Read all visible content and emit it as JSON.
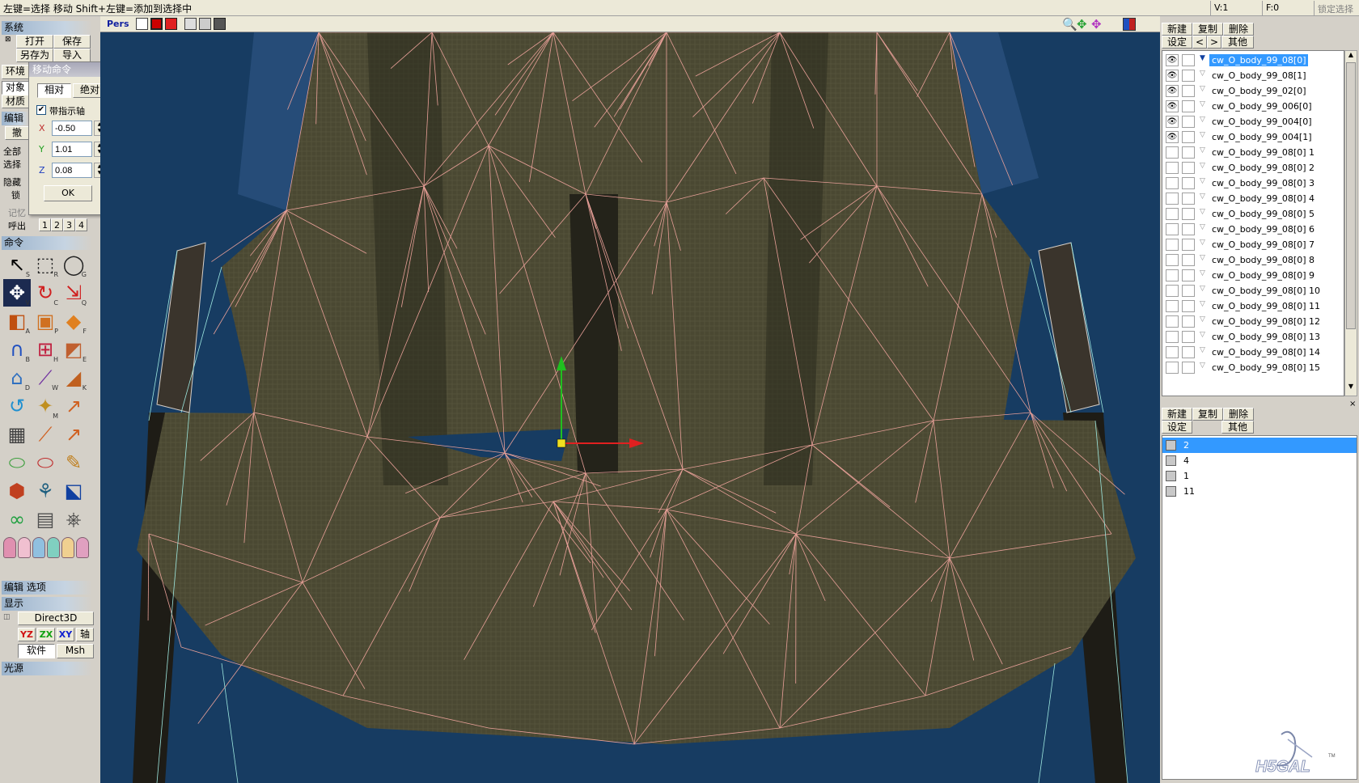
{
  "status_bar": {
    "hint": "左键=选择 移动  Shift+左键=添加到选择中",
    "vertex_count": "V:1",
    "face_count": "F:0",
    "lock_label": "锁定选择"
  },
  "left_panel": {
    "system_header": "系统",
    "open_label": "打开",
    "save_label": "保存",
    "saveas_label": "另存为",
    "import_label": "导入",
    "env_label": "环境",
    "object_label": "对象",
    "material_label": "材质",
    "edit_header": "编辑",
    "edit_btn_label": "撤",
    "all_label": "全部",
    "select_label": "选择",
    "hide_label": "隐藏",
    "lock_label": "锁",
    "memory_label": "记忆",
    "recall_label": "呼出",
    "slots": [
      "1",
      "2",
      "3",
      "4"
    ],
    "command_header": "命令",
    "edit_option_header": "编辑 选项",
    "display_header": "显示",
    "display_mode": "Direct3D",
    "axis_yz": "YZ",
    "axis_zx": "ZX",
    "axis_xy": "XY",
    "axis_label": "轴",
    "software_label": "软件",
    "msh_label": "Msh",
    "light_header": "光源",
    "tools": [
      {
        "icon": "select-arrow-icon",
        "key": "S"
      },
      {
        "icon": "rect-select-icon",
        "key": "R"
      },
      {
        "icon": "lasso-icon",
        "key": "G"
      },
      {
        "icon": "move-icon",
        "key": "V"
      },
      {
        "icon": "rotate-icon",
        "key": "C"
      },
      {
        "icon": "scale-icon",
        "key": "Q"
      },
      {
        "icon": "face-create-icon",
        "key": "A"
      },
      {
        "icon": "box-icon",
        "key": "P"
      },
      {
        "icon": "plane-icon",
        "key": "F"
      },
      {
        "icon": "magnet-icon",
        "key": "B"
      },
      {
        "icon": "knife-icon",
        "key": "H"
      },
      {
        "icon": "extrude-icon",
        "key": "E"
      },
      {
        "icon": "delete-bucket-icon",
        "key": "D"
      },
      {
        "icon": "weld-icon",
        "key": "W"
      },
      {
        "icon": "bevel-icon",
        "key": "K"
      },
      {
        "icon": "twist-icon",
        "key": ""
      },
      {
        "icon": "wand-icon",
        "key": "M"
      },
      {
        "icon": "bend-icon",
        "key": ""
      },
      {
        "icon": "lattice-icon",
        "key": ""
      },
      {
        "icon": "curve-icon",
        "key": ""
      },
      {
        "icon": "path-icon",
        "key": ""
      },
      {
        "icon": "cylinder-icon",
        "key": ""
      },
      {
        "icon": "cylinder-edit-icon",
        "key": ""
      },
      {
        "icon": "paint-icon",
        "key": ""
      },
      {
        "icon": "cube-edit-icon",
        "key": ""
      },
      {
        "icon": "bone-icon",
        "key": ""
      },
      {
        "icon": "nodes-icon",
        "key": ""
      },
      {
        "icon": "link-icon",
        "key": ""
      },
      {
        "icon": "script-icon",
        "key": ""
      },
      {
        "icon": "camera-icon",
        "key": ""
      }
    ]
  },
  "move_dialog": {
    "title": "移动命令",
    "relative_label": "相对",
    "absolute_label": "绝对",
    "show_axis_label": "带指示轴",
    "x_label": "X",
    "y_label": "Y",
    "z_label": "Z",
    "x_value": "-0.50",
    "y_value": "1.01",
    "z_value": "0.08",
    "ok_label": "OK"
  },
  "viewport": {
    "mode_label": "Pers"
  },
  "object_panel": {
    "new_label": "新建",
    "copy_label": "复制",
    "delete_label": "删除",
    "settings_label": "设定",
    "prev_label": "<",
    "next_label": ">",
    "other_label": "其他",
    "objects": [
      {
        "name": "cw_O_body_99_08[0]",
        "visible": true,
        "selected": true,
        "expand": "▼"
      },
      {
        "name": "cw_O_body_99_08[1]",
        "visible": true,
        "selected": false,
        "expand": "▽"
      },
      {
        "name": "cw_O_body_99_02[0]",
        "visible": true,
        "selected": false,
        "expand": "▽"
      },
      {
        "name": "cw_O_body_99_006[0]",
        "visible": true,
        "selected": false,
        "expand": "▽"
      },
      {
        "name": "cw_O_body_99_004[0]",
        "visible": true,
        "selected": false,
        "expand": "▽"
      },
      {
        "name": "cw_O_body_99_004[1]",
        "visible": true,
        "selected": false,
        "expand": "▽"
      },
      {
        "name": "cw_O_body_99_08[0] 1",
        "visible": false,
        "selected": false,
        "expand": "▽"
      },
      {
        "name": "cw_O_body_99_08[0] 2",
        "visible": false,
        "selected": false,
        "expand": "▽"
      },
      {
        "name": "cw_O_body_99_08[0] 3",
        "visible": false,
        "selected": false,
        "expand": "▽"
      },
      {
        "name": "cw_O_body_99_08[0] 4",
        "visible": false,
        "selected": false,
        "expand": "▽"
      },
      {
        "name": "cw_O_body_99_08[0] 5",
        "visible": false,
        "selected": false,
        "expand": "▽"
      },
      {
        "name": "cw_O_body_99_08[0] 6",
        "visible": false,
        "selected": false,
        "expand": "▽"
      },
      {
        "name": "cw_O_body_99_08[0] 7",
        "visible": false,
        "selected": false,
        "expand": "▽"
      },
      {
        "name": "cw_O_body_99_08[0] 8",
        "visible": false,
        "selected": false,
        "expand": "▽"
      },
      {
        "name": "cw_O_body_99_08[0] 9",
        "visible": false,
        "selected": false,
        "expand": "▽"
      },
      {
        "name": "cw_O_body_99_08[0] 10",
        "visible": false,
        "selected": false,
        "expand": "▽"
      },
      {
        "name": "cw_O_body_99_08[0] 11",
        "visible": false,
        "selected": false,
        "expand": "▽"
      },
      {
        "name": "cw_O_body_99_08[0] 12",
        "visible": false,
        "selected": false,
        "expand": "▽"
      },
      {
        "name": "cw_O_body_99_08[0] 13",
        "visible": false,
        "selected": false,
        "expand": "▽"
      },
      {
        "name": "cw_O_body_99_08[0] 14",
        "visible": false,
        "selected": false,
        "expand": "▽"
      },
      {
        "name": "cw_O_body_99_08[0] 15",
        "visible": false,
        "selected": false,
        "expand": "▽"
      }
    ]
  },
  "material_panel": {
    "new_label": "新建",
    "copy_label": "复制",
    "delete_label": "删除",
    "settings_label": "设定",
    "other_label": "其他",
    "materials": [
      {
        "name": "2",
        "selected": true
      },
      {
        "name": "4",
        "selected": false
      },
      {
        "name": "1",
        "selected": false
      },
      {
        "name": "11",
        "selected": false
      }
    ]
  },
  "watermark": {
    "text": "H5GAL",
    "tm": "TM"
  },
  "colors": {
    "selection_blue": "#3399ff",
    "viewport_bg": "#173c62",
    "wire_pink": "#e8a098",
    "wire_cyan": "#9ee8e0"
  }
}
